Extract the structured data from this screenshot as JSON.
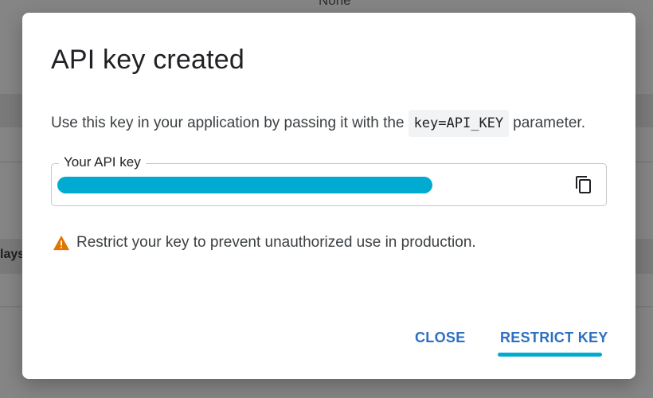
{
  "background": {
    "top_text": "None",
    "left_text": "lays"
  },
  "dialog": {
    "title": "API key created",
    "description_before": "Use this key in your application by passing it with the",
    "description_code": "key=API_KEY",
    "description_after": "parameter.",
    "key_field": {
      "label": "Your API key",
      "value_redacted": true,
      "copy_icon": "copy-icon"
    },
    "warning": {
      "icon": "warning-triangle-icon",
      "text": "Restrict your key to prevent unauthorized use in production."
    },
    "actions": {
      "close_label": "CLOSE",
      "restrict_label": "RESTRICT KEY"
    }
  },
  "colors": {
    "accent": "#00aad0",
    "button_text": "#2d6fc1",
    "warning": "#e37400"
  }
}
